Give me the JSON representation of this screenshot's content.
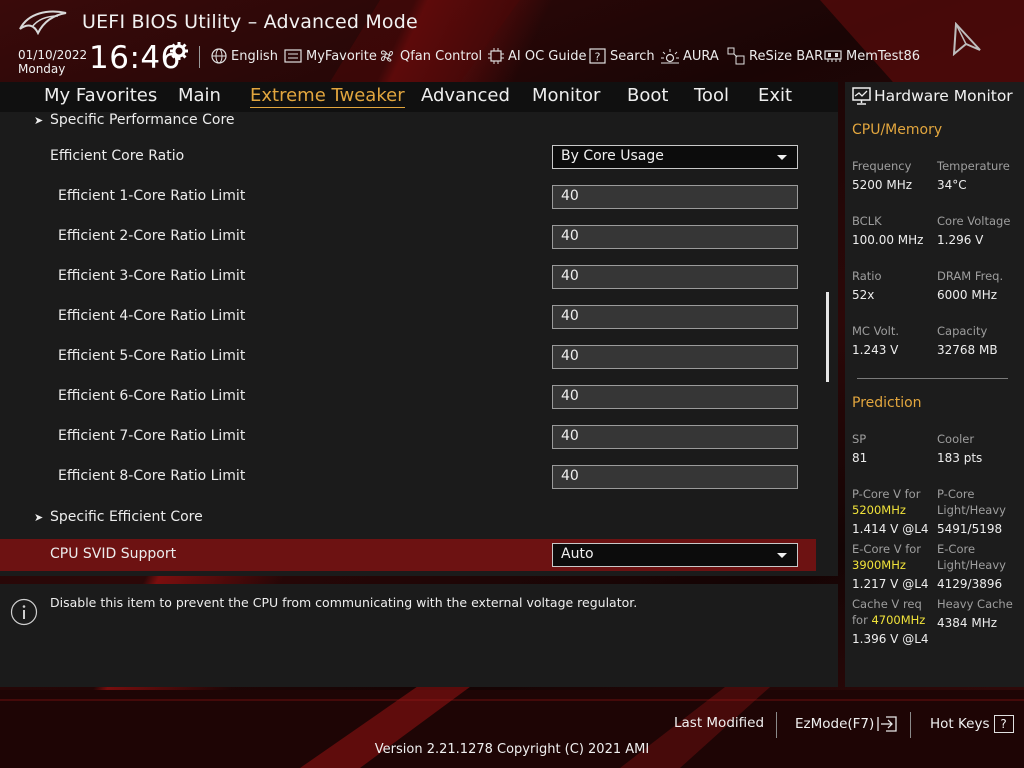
{
  "header": {
    "title": "UEFI BIOS Utility – Advanced Mode",
    "date": "01/10/2022",
    "day": "Monday",
    "time": "16:46",
    "toolbar": [
      {
        "label": "English",
        "icon": "globe-icon"
      },
      {
        "label": "MyFavorite",
        "icon": "favorite-icon"
      },
      {
        "label": "Qfan Control",
        "icon": "fan-icon"
      },
      {
        "label": "AI OC Guide",
        "icon": "chip-icon"
      },
      {
        "label": "Search",
        "icon": "question-box-icon"
      },
      {
        "label": "AURA",
        "icon": "aura-icon"
      },
      {
        "label": "ReSize BAR",
        "icon": "resize-bar-icon"
      },
      {
        "label": "MemTest86",
        "icon": "memory-icon"
      }
    ]
  },
  "nav": {
    "tabs": [
      "My Favorites",
      "Main",
      "Extreme Tweaker",
      "Advanced",
      "Monitor",
      "Boot",
      "Tool",
      "Exit"
    ],
    "active": "Extreme Tweaker"
  },
  "settings": {
    "specific_performance_core": "Specific Performance Core",
    "efficient_core_ratio": {
      "label": "Efficient Core Ratio",
      "value": "By Core Usage"
    },
    "limits": [
      {
        "label": "Efficient 1-Core Ratio Limit",
        "value": "40"
      },
      {
        "label": "Efficient 2-Core Ratio Limit",
        "value": "40"
      },
      {
        "label": "Efficient 3-Core Ratio Limit",
        "value": "40"
      },
      {
        "label": "Efficient 4-Core Ratio Limit",
        "value": "40"
      },
      {
        "label": "Efficient 5-Core Ratio Limit",
        "value": "40"
      },
      {
        "label": "Efficient 6-Core Ratio Limit",
        "value": "40"
      },
      {
        "label": "Efficient 7-Core Ratio Limit",
        "value": "40"
      },
      {
        "label": "Efficient 8-Core Ratio Limit",
        "value": "40"
      }
    ],
    "specific_efficient_core": "Specific Efficient Core",
    "cpu_svid_support": {
      "label": "CPU SVID Support",
      "value": "Auto"
    }
  },
  "help": {
    "text": "Disable this item to prevent the CPU from communicating with the external voltage regulator."
  },
  "hardware_monitor": {
    "title": "Hardware Monitor",
    "cpu_memory": {
      "section": "CPU/Memory",
      "frequency_label": "Frequency",
      "frequency": "5200 MHz",
      "temperature_label": "Temperature",
      "temperature": "34°C",
      "bclk_label": "BCLK",
      "bclk": "100.00 MHz",
      "core_voltage_label": "Core Voltage",
      "core_voltage": "1.296 V",
      "ratio_label": "Ratio",
      "ratio": "52x",
      "dram_freq_label": "DRAM Freq.",
      "dram_freq": "6000 MHz",
      "mc_volt_label": "MC Volt.",
      "mc_volt": "1.243 V",
      "capacity_label": "Capacity",
      "capacity": "32768 MB"
    },
    "prediction": {
      "section": "Prediction",
      "sp_label": "SP",
      "sp": "81",
      "cooler_label": "Cooler",
      "cooler": "183 pts",
      "pcore_v_label": "P-Core V for",
      "pcore_v_freq": "5200MHz",
      "pcore_v": "1.414 V @L4",
      "pcore_lh_label_1": "P-Core",
      "pcore_lh_label_2": "Light/Heavy",
      "pcore_lh": "5491/5198",
      "ecore_v_label": "E-Core V for",
      "ecore_v_freq": "3900MHz",
      "ecore_v": "1.217 V @L4",
      "ecore_lh_label_1": "E-Core",
      "ecore_lh_label_2": "Light/Heavy",
      "ecore_lh": "4129/3896",
      "cache_v_label_1": "Cache V req",
      "cache_v_label_2": "for",
      "cache_v_freq": "4700MHz",
      "cache_v": "1.396 V @L4",
      "heavy_cache_label": "Heavy Cache",
      "heavy_cache": "4384 MHz"
    }
  },
  "footer": {
    "last_modified": "Last Modified",
    "ezmode": "EzMode(F7)",
    "hot_keys": "Hot Keys",
    "hot_keys_key": "?",
    "version": "Version 2.21.1278 Copyright (C) 2021 AMI"
  },
  "colors": {
    "accent": "#e2a63e",
    "selected_row": "#6d1212",
    "highlight_freq": "#f0e23a"
  }
}
